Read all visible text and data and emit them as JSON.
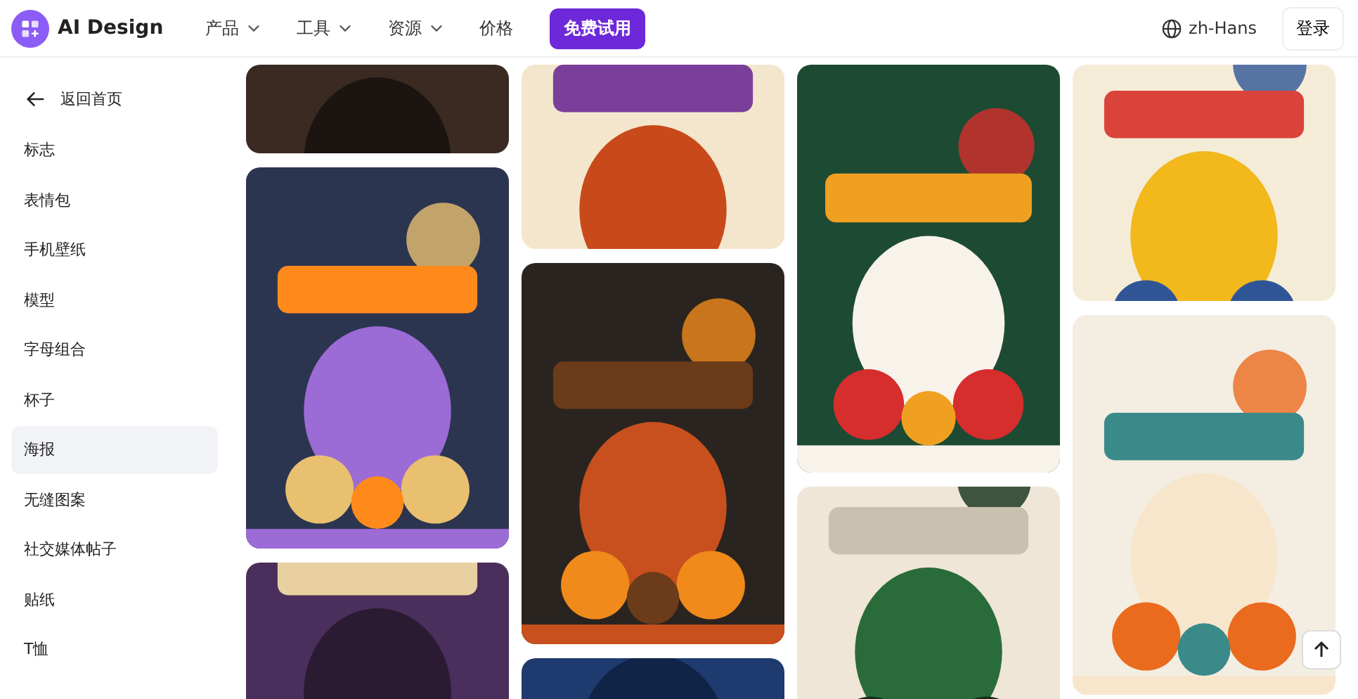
{
  "header": {
    "brand": "AI Design",
    "nav": [
      {
        "label": "产品",
        "dropdown": true
      },
      {
        "label": "工具",
        "dropdown": true
      },
      {
        "label": "资源",
        "dropdown": true
      },
      {
        "label": "价格",
        "dropdown": false
      }
    ],
    "cta": "免费试用",
    "language": "zh-Hans",
    "login": "登录"
  },
  "sidebar": {
    "back": "返回首页",
    "items": [
      {
        "label": "标志",
        "selected": false
      },
      {
        "label": "表情包",
        "selected": false
      },
      {
        "label": "手机壁纸",
        "selected": false
      },
      {
        "label": "模型",
        "selected": false
      },
      {
        "label": "字母组合",
        "selected": false
      },
      {
        "label": "杯子",
        "selected": false
      },
      {
        "label": "海报",
        "selected": true
      },
      {
        "label": "无缝图案",
        "selected": false
      },
      {
        "label": "社交媒体帖子",
        "selected": false
      },
      {
        "label": "贴纸",
        "selected": false
      },
      {
        "label": "T恤",
        "selected": false
      }
    ]
  }
}
